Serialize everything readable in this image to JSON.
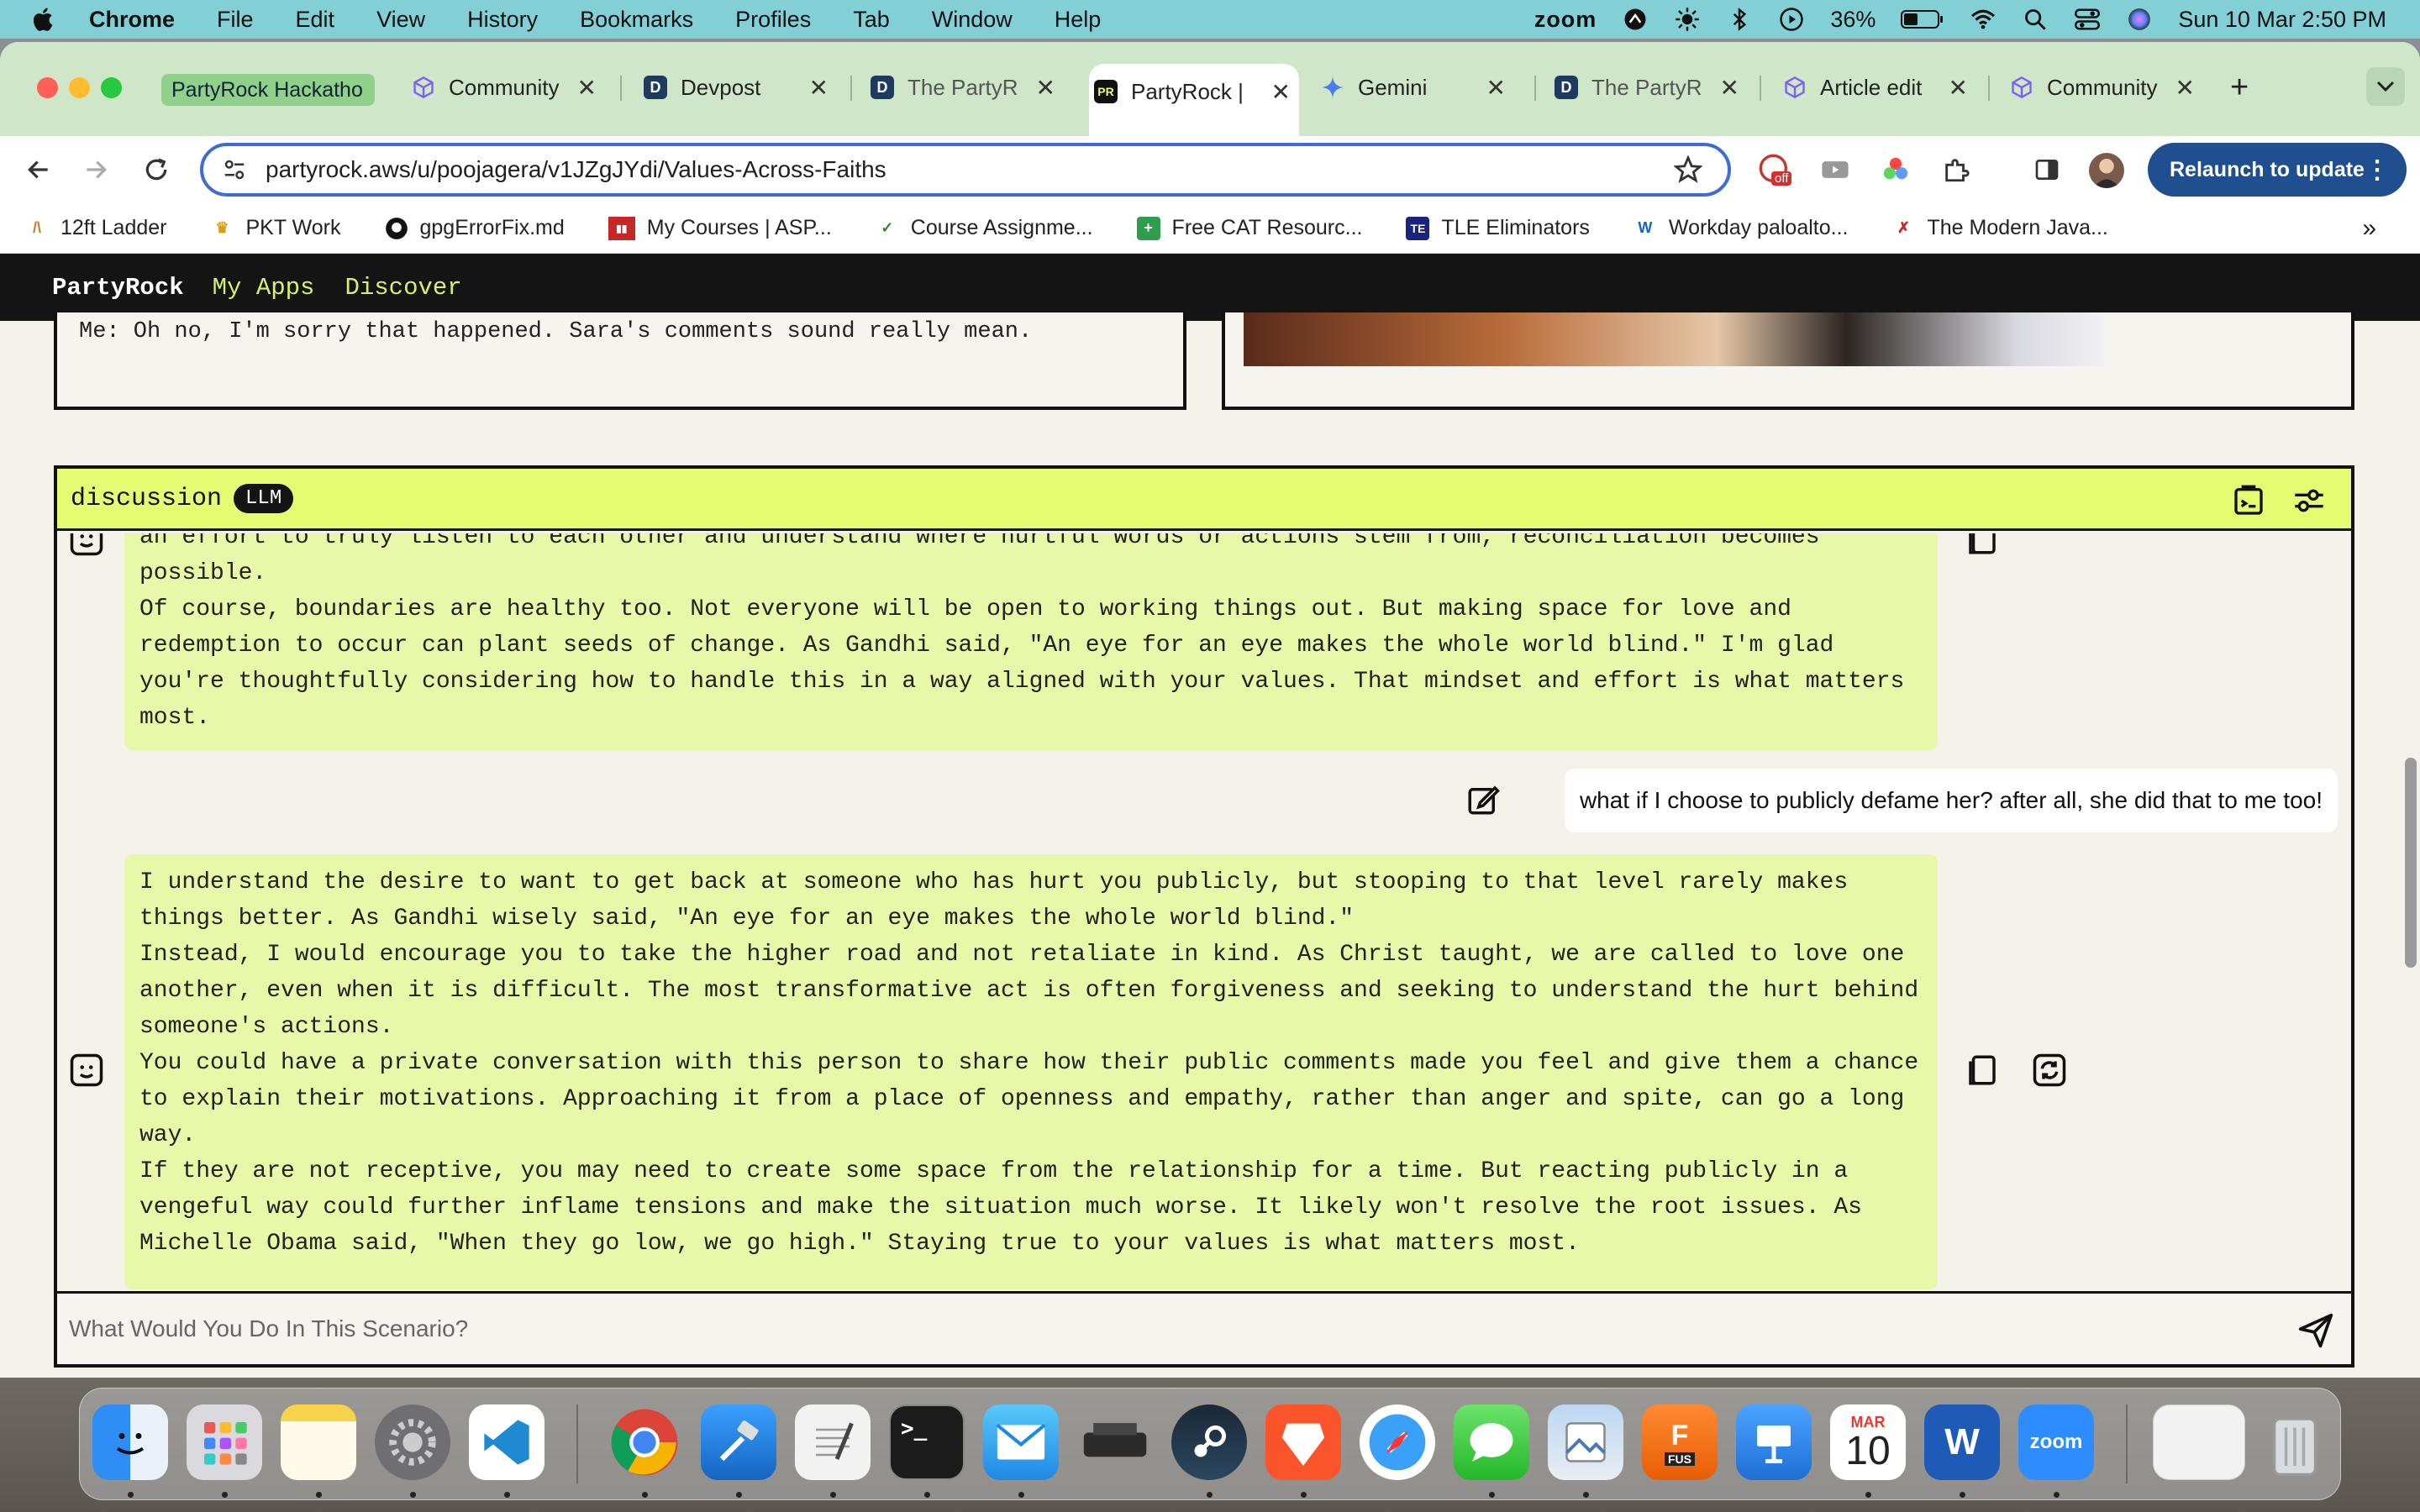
{
  "menubar": {
    "app_name": "Chrome",
    "items": [
      "File",
      "Edit",
      "View",
      "History",
      "Bookmarks",
      "Profiles",
      "Tab",
      "Window",
      "Help"
    ],
    "zoom_label": "zoom",
    "battery": "36%",
    "datetime": "Sun 10 Mar  2:50 PM"
  },
  "tabs": {
    "group_chip": "PartyRock Hackatho",
    "items": [
      {
        "title": "Community"
      },
      {
        "title": "Devpost"
      },
      {
        "title": "The PartyR"
      },
      {
        "title": "PartyRock |"
      },
      {
        "title": "Gemini"
      },
      {
        "title": "The PartyR"
      },
      {
        "title": "Article edit"
      },
      {
        "title": "Community"
      }
    ],
    "new_tab_label": "+"
  },
  "toolbar": {
    "url": "partyrock.aws/u/poojagera/v1JZgJYdi/Values-Across-Faiths",
    "relaunch_label": "Relaunch to update",
    "extension_badge": "off"
  },
  "bookmarks": [
    "12ft Ladder",
    "PKT Work",
    "gpgErrorFix.md",
    "My Courses | ASP...",
    "Course Assignme...",
    "Free CAT Resourc...",
    "TLE Eliminators",
    "Workday paloalto...",
    "The Modern Java..."
  ],
  "partyrock": {
    "brand": "PartyRock",
    "nav_links": [
      "My Apps",
      "Discover"
    ],
    "upper_card_text": "Me: Oh no, I'm sorry that happened. Sara's comments sound really mean."
  },
  "discussion": {
    "title": "discussion",
    "badge": "LLM",
    "first_bubble": [
      "an effort to truly listen to each other and understand where hurtful words or actions stem from, reconciliation becomes",
      "possible.",
      "Of course, boundaries are healthy too. Not everyone will be open to working things out. But making space for love and",
      "redemption to occur can plant seeds of change. As Gandhi said, \"An eye for an eye makes the whole world blind.\" I'm glad",
      "you're thoughtfully considering how to handle this in a way aligned with your values. That mindset and effort is what matters",
      "most."
    ],
    "user_message": "what if I choose to publicly defame her? after all, she did that to me too!",
    "second_bubble": [
      "I understand the desire to want to get back at someone who has hurt you publicly, but stooping to that level rarely makes",
      "things better. As Gandhi wisely said, \"An eye for an eye makes the whole world blind.\"",
      "Instead, I would encourage you to take the higher road and not retaliate in kind. As Christ taught, we are called to love one",
      "another, even when it is difficult. The most transformative act is often forgiveness and seeking to understand the hurt behind",
      "someone's actions.",
      "You could have a private conversation with this person to share how their public comments made you feel and give them a chance",
      "to explain their motivations. Approaching it from a place of openness and empathy, rather than anger and spite, can go a long",
      "way.",
      "If they are not receptive, you may need to create some space from the relationship for a time. But reacting publicly in a",
      "vengeful way could further inflame tensions and make the situation much worse. It likely won't resolve the root issues. As",
      "Michelle Obama said, \"When they go low, we go high.\" Staying true to your values is what matters most."
    ],
    "input_placeholder": "What Would You Do In This Scenario?"
  },
  "dock": {
    "calendar_month": "MAR",
    "calendar_day": "10",
    "zoom_label": "zoom",
    "fusion_label": "FUS"
  },
  "colors": {
    "partyrock_accent": "#e4fb72",
    "bubble_bg": "#e7f8a8",
    "nav_link": "#d7f06a",
    "relaunch_bg": "#1f4f8f",
    "tabstrip_bg": "#cfe7c8"
  }
}
